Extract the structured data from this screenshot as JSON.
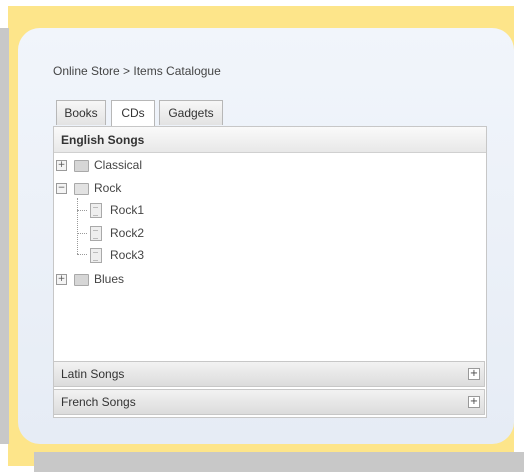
{
  "breadcrumb": "Online Store > Items Catalogue",
  "tabs": [
    {
      "label": "Books"
    },
    {
      "label": "CDs",
      "active": true
    },
    {
      "label": "Gadgets"
    }
  ],
  "panel": {
    "title": "English Songs",
    "tree": [
      {
        "label": "Classical",
        "expanded": false,
        "toggle": "+"
      },
      {
        "label": "Rock",
        "expanded": true,
        "toggle": "−",
        "children": [
          {
            "label": "Rock1"
          },
          {
            "label": "Rock2"
          },
          {
            "label": "Rock3"
          }
        ]
      },
      {
        "label": "Blues",
        "expanded": false,
        "toggle": "+"
      }
    ]
  },
  "accordion": [
    {
      "label": "Latin Songs",
      "toggle": "+"
    },
    {
      "label": "French Songs",
      "toggle": "+"
    }
  ],
  "colors": {
    "frame": "#fde58a",
    "card": "#e6ecf5",
    "outer_gray": "#c8c8c8"
  }
}
